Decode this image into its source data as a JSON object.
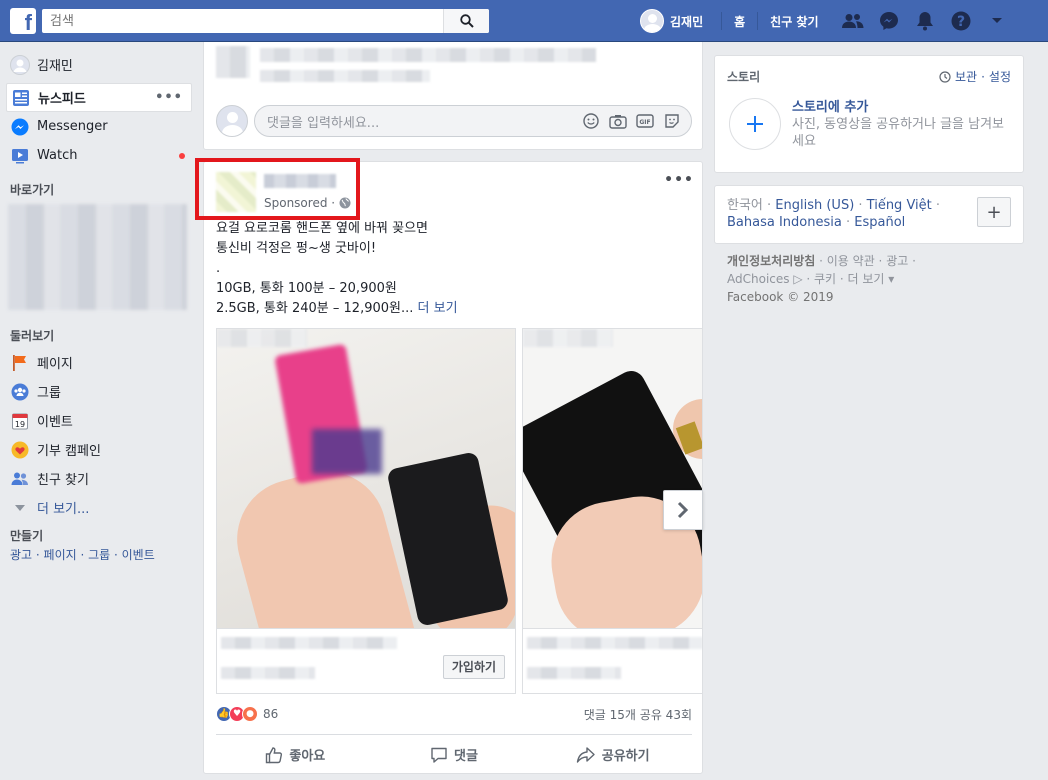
{
  "topbar": {
    "logo": "f",
    "search_placeholder": "검색",
    "profile_name": "김재민",
    "home": "홈",
    "find_friends": "친구 찾기",
    "bg_color": "#4267b2"
  },
  "leftnav": {
    "profile_name": "김재민",
    "items": [
      {
        "label": "뉴스피드",
        "icon": "newsfeed-icon"
      },
      {
        "label": "Messenger",
        "icon": "messenger-icon"
      },
      {
        "label": "Watch",
        "icon": "watch-icon"
      }
    ],
    "more_dots": "•••",
    "shortcuts_heading": "바로가기",
    "explore_heading": "둘러보기",
    "explore_items": [
      {
        "label": "페이지",
        "icon": "flag-icon"
      },
      {
        "label": "그룹",
        "icon": "groups-icon"
      },
      {
        "label": "이벤트",
        "icon": "calendar-icon"
      },
      {
        "label": "기부 캠페인",
        "icon": "fundraiser-icon"
      },
      {
        "label": "친구 찾기",
        "icon": "friends-icon"
      }
    ],
    "see_more": "더 보기...",
    "create_heading": "만들기",
    "create_links": "광고 · 페이지 · 그룹 · 이벤트"
  },
  "comment": {
    "placeholder": "댓글을 입력하세요..."
  },
  "ad": {
    "sponsored": "Sponsored ·",
    "menu": "•••",
    "text_line1": "요걸 요로코롬 핸드폰 옆에 바꿔 꽂으면",
    "text_line2": "통신비 걱정은 펑~생 굿바이!",
    "text_line3": ".",
    "text_line4": "10GB, 통화 100분 – 20,900원",
    "text_line5": "2.5GB, 통화 240분 – 12,900원...",
    "see_more": "더 보기",
    "join_button": "가입하기",
    "reaction_count": "86",
    "stats": "댓글 15개  공유 43회",
    "like": "좋아요",
    "comment": "댓글",
    "share": "공유하기",
    "highlight_color": "#e3171c"
  },
  "stories": {
    "title": "스토리",
    "archive": "보관",
    "settings": "설정",
    "add_title": "스토리에 추가",
    "add_sub": "사진, 동영상을 공유하거나 글을 남겨보세요"
  },
  "langs": {
    "current": "한국어 · ",
    "l1": "English (US)",
    "l2": "Tiếng Việt",
    "l3": "Bahasa Indonesia",
    "l4": "Español",
    "plus": "+"
  },
  "footer": {
    "privacy": "개인정보처리방침",
    "rest1": " · 이용 약관 · 광고 · ",
    "rest2": "AdChoices ▷ · 쿠키 · 더 보기 ▾",
    "copyright": "Facebook © 2019"
  }
}
